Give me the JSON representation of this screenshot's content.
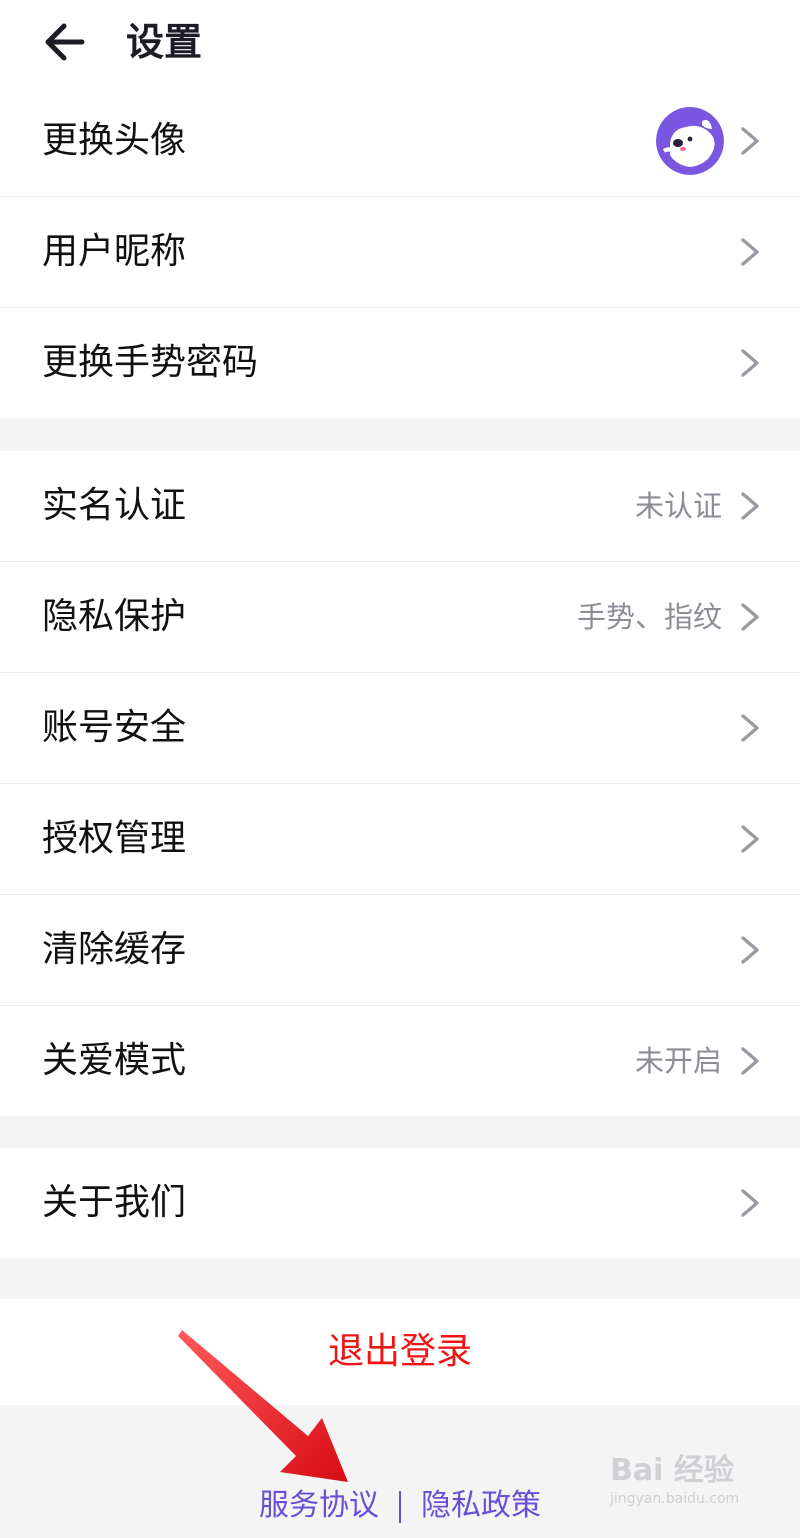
{
  "header": {
    "title": "设置",
    "back_icon": "back-arrow-icon"
  },
  "groups": [
    {
      "items": [
        {
          "label": "更换头像",
          "value": "",
          "has_avatar": true
        },
        {
          "label": "用户昵称",
          "value": ""
        },
        {
          "label": "更换手势密码",
          "value": ""
        }
      ]
    },
    {
      "items": [
        {
          "label": "实名认证",
          "value": "未认证"
        },
        {
          "label": "隐私保护",
          "value": "手势、指纹"
        },
        {
          "label": "账号安全",
          "value": ""
        },
        {
          "label": "授权管理",
          "value": ""
        },
        {
          "label": "清除缓存",
          "value": ""
        },
        {
          "label": "关爱模式",
          "value": "未开启"
        }
      ]
    },
    {
      "items": [
        {
          "label": "关于我们",
          "value": ""
        }
      ]
    }
  ],
  "logout": {
    "label": "退出登录",
    "color": "#f01414"
  },
  "footer": {
    "service_agreement": "服务协议",
    "privacy_policy": "隐私政策",
    "link_color": "#6a4fd6"
  },
  "annotation": {
    "arrow_color": "#e8141c",
    "arrow_icon": "red-pointer-arrow"
  },
  "watermark": {
    "main": "Bai 经验",
    "sub": "jingyan.baidu.com"
  },
  "colors": {
    "background": "#f4f4f5",
    "card": "#ffffff",
    "chevron": "#9a9aa2",
    "value_text": "#8d8d95",
    "avatar_bg": "#7b56e0"
  }
}
